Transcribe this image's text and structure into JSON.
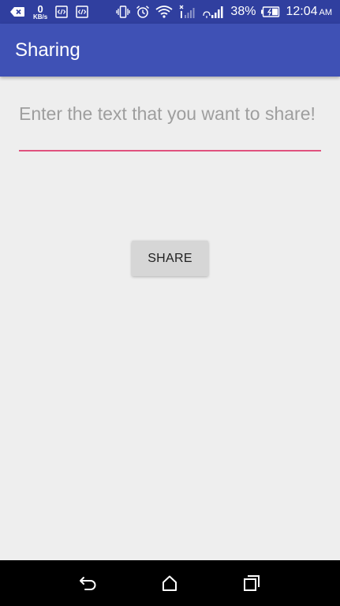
{
  "status_bar": {
    "data_rate_value": "0",
    "data_rate_unit": "KB/s",
    "battery_percent": "38%",
    "time": "12:04",
    "ampm": "AM",
    "icons": [
      "back-notification-icon",
      "code-icon",
      "code-icon",
      "vibrate-icon",
      "alarm-icon",
      "wifi-icon",
      "signal-icon",
      "signal-icon",
      "battery-icon"
    ]
  },
  "app_bar": {
    "title": "Sharing",
    "color": "#3F51B5",
    "status_color": "#303F9F"
  },
  "share_input": {
    "value": "",
    "placeholder": "Enter the text that you want to share!",
    "accent_color": "#E0527E"
  },
  "share_button": {
    "label": "SHARE"
  },
  "navigation_bar": {
    "icons": [
      "back-icon",
      "home-icon",
      "recents-icon"
    ]
  }
}
